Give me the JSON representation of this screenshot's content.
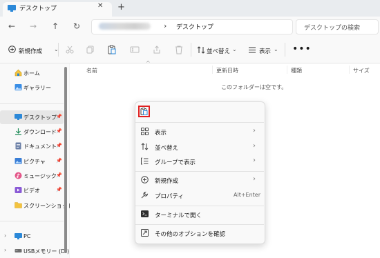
{
  "tab": {
    "title": "デスクトップ",
    "close_glyph": "✕",
    "new_tab_glyph": "+"
  },
  "nav": {
    "back": "←",
    "forward": "→",
    "up": "↑",
    "refresh": "↻"
  },
  "address": {
    "chevron": "›",
    "location": "デスクトップ"
  },
  "search": {
    "placeholder": "デスクトップの検索"
  },
  "toolbar": {
    "new_label": "新規作成",
    "sort_label": "並べ替え",
    "view_label": "表示",
    "more": "•••",
    "dropdown_glyph": "⌄"
  },
  "sidebar": {
    "quick": [
      {
        "label": "ホーム",
        "icon": "home-icon"
      },
      {
        "label": "ギャラリー",
        "icon": "gallery-icon"
      }
    ],
    "pinned": [
      {
        "label": "デスクトップ",
        "icon": "desktop-icon",
        "pinned": true,
        "selected": true
      },
      {
        "label": "ダウンロード",
        "icon": "download-icon",
        "pinned": true
      },
      {
        "label": "ドキュメント",
        "icon": "document-icon",
        "pinned": true
      },
      {
        "label": "ピクチャ",
        "icon": "pictures-icon",
        "pinned": true
      },
      {
        "label": "ミュージック",
        "icon": "music-icon",
        "pinned": true
      },
      {
        "label": "ビデオ",
        "icon": "video-icon",
        "pinned": true
      },
      {
        "label": "スクリーンショット",
        "icon": "folder-icon",
        "pinned": false
      }
    ],
    "devices": [
      {
        "label": "PC",
        "icon": "pc-icon"
      },
      {
        "label": "USBメモリー (D:)",
        "icon": "usb-drive-icon"
      }
    ],
    "pin_glyph": "📌",
    "expand_glyph": "›"
  },
  "columns": {
    "name": "名前",
    "modified": "更新日時",
    "type": "種類",
    "size": "サイズ",
    "sort_caret": "^"
  },
  "empty_message": "このフォルダーは空です。",
  "context_menu": {
    "paste_icon": "paste-icon",
    "group1": [
      {
        "label": "表示",
        "icon": "view-icon",
        "submenu": "›"
      },
      {
        "label": "並べ替え",
        "icon": "sort-icon",
        "submenu": "›"
      },
      {
        "label": "グループで表示",
        "icon": "group-icon",
        "submenu": "›"
      }
    ],
    "group2": [
      {
        "label": "新規作成",
        "icon": "new-icon",
        "submenu": "›"
      },
      {
        "label": "プロパティ",
        "icon": "properties-icon",
        "shortcut": "Alt+Enter"
      }
    ],
    "group3": [
      {
        "label": "ターミナルで開く",
        "icon": "terminal-icon"
      }
    ],
    "group4": [
      {
        "label": "その他のオプションを確認",
        "icon": "more-options-icon"
      }
    ]
  },
  "colors": {
    "highlight_border": "#e02020",
    "folder_blue": "#2b88d8",
    "folder_yellow": "#f3c33f"
  }
}
